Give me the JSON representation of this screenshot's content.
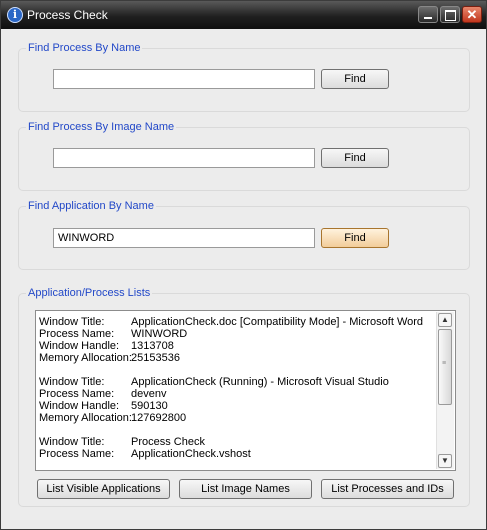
{
  "window": {
    "title": "Process Check"
  },
  "groups": {
    "by_name": {
      "label": "Find Process By Name",
      "value": "",
      "button": "Find"
    },
    "by_image": {
      "label": "Find Process By Image Name",
      "value": "",
      "button": "Find"
    },
    "by_app": {
      "label": "Find Application By Name",
      "value": "WINWORD",
      "button": "Find"
    },
    "lists": {
      "label": "Application/Process Lists"
    }
  },
  "list_labels": {
    "window_title": "Window Title:",
    "process_name": "Process Name:",
    "window_handle": "Window Handle:",
    "memory_allocation": "Memory Allocation:"
  },
  "entries": [
    {
      "window_title": "ApplicationCheck.doc [Compatibility Mode] - Microsoft Word",
      "process_name": "WINWORD",
      "window_handle": "1313708",
      "memory_allocation": "25153536"
    },
    {
      "window_title": "ApplicationCheck (Running) - Microsoft Visual Studio",
      "process_name": "devenv",
      "window_handle": "590130",
      "memory_allocation": "127692800"
    },
    {
      "window_title": "Process Check",
      "process_name": "ApplicationCheck.vshost"
    }
  ],
  "buttons": {
    "list_visible": "List Visible Applications",
    "list_images": "List Image Names",
    "list_processes": "List Processes and IDs"
  }
}
